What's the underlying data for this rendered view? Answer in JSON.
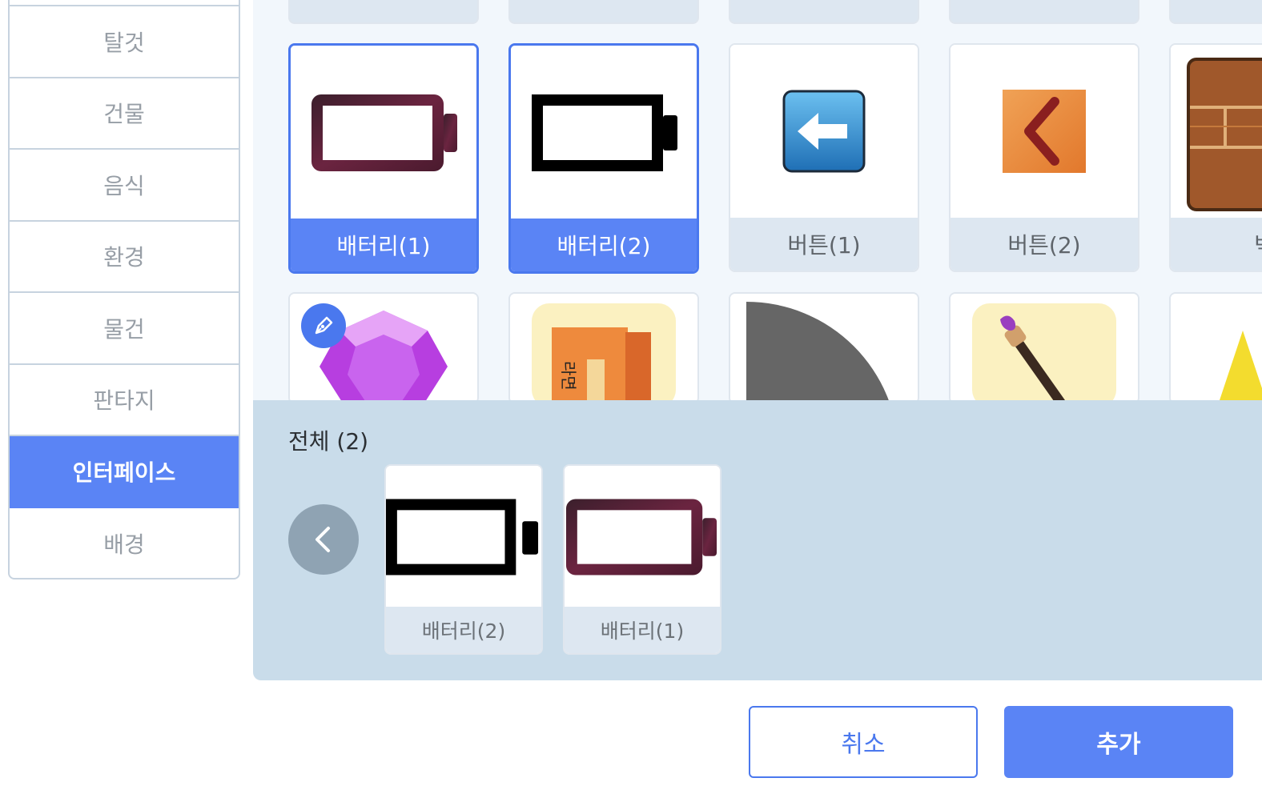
{
  "sidebar": {
    "items": [
      {
        "label": ""
      },
      {
        "label": "탈것"
      },
      {
        "label": "건물"
      },
      {
        "label": "음식"
      },
      {
        "label": "환경"
      },
      {
        "label": "물건"
      },
      {
        "label": "판타지"
      },
      {
        "label": "인터페이스"
      },
      {
        "label": "배경"
      }
    ],
    "active": "인터페이스"
  },
  "grid": {
    "row1": [
      {
        "label": "배터리(1)",
        "selected": true
      },
      {
        "label": "배터리(2)",
        "selected": true
      },
      {
        "label": "버튼(1)",
        "selected": false
      },
      {
        "label": "버튼(2)",
        "selected": false
      },
      {
        "label": "벽",
        "selected": false
      }
    ]
  },
  "tray": {
    "title": "전체 (2)",
    "items": [
      {
        "label": "배터리(2)"
      },
      {
        "label": "배터리(1)"
      }
    ]
  },
  "actions": {
    "cancel_label": "취소",
    "add_label": "추가"
  },
  "colors": {
    "accent": "#5a84f5",
    "tray_bg": "#c9dcea",
    "grid_bg": "#f2f7fc"
  }
}
